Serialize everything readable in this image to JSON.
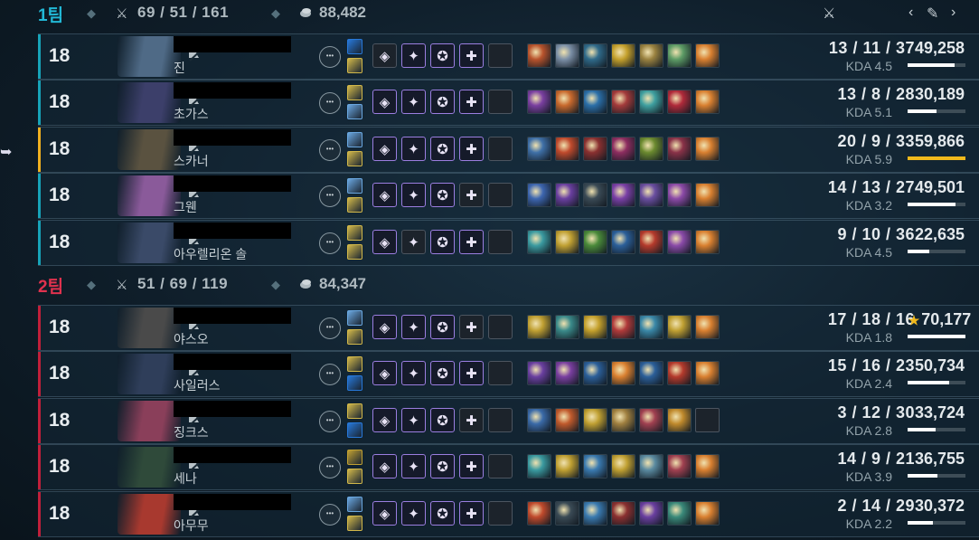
{
  "header": {
    "icons": [
      "crossed-swords-icon",
      "chevron-left-icon",
      "tools-icon",
      "chevron-right-icon"
    ]
  },
  "teams": [
    {
      "name": "1팀",
      "name_color": "#22b8d6",
      "kda": "69 / 51 / 161",
      "gold": "88,482",
      "players": [
        {
          "level": "18",
          "champion": "진",
          "score": "13 / 11 / 37",
          "kda": "KDA 4.5",
          "damage": "49,258",
          "damage_share": 0.82,
          "face": "#4f6a86",
          "spells": [
            "#2778d9",
            "#d2b84a"
          ],
          "runes": [
            "dim",
            "",
            "",
            ""
          ],
          "items": [
            "#b8532c",
            "#7b8fa6",
            "#2f6a8a",
            "#c4a02c",
            "#9a8240",
            "#5d9c66",
            "#d98030"
          ]
        },
        {
          "level": "18",
          "champion": "초가스",
          "score": "13 / 8 / 28",
          "kda": "KDA 5.1",
          "damage": "30,189",
          "damage_share": 0.5,
          "face": "#3c3f6a",
          "spells": [
            "#d2b84a",
            "#6aa7e0"
          ],
          "runes": [
            "",
            "",
            "",
            ""
          ],
          "items": [
            "#7a3fa0",
            "#c8692d",
            "#2b6fa8",
            "#a33b3b",
            "#3fa0a0",
            "#b02a3a",
            "#d98030"
          ]
        },
        {
          "level": "18",
          "champion": "스카너",
          "score": "20 / 9 / 33",
          "kda": "KDA 5.9",
          "damage": "59,866",
          "damage_share": 1.0,
          "face": "#5a5240",
          "spells": [
            "#6aa7e0",
            "#d2b84a"
          ],
          "runes": [
            "",
            "",
            "",
            ""
          ],
          "items": [
            "#3f70a8",
            "#c04a2c",
            "#8a3030",
            "#8d2d60",
            "#6b8a2f",
            "#8a3248",
            "#d98030"
          ]
        },
        {
          "level": "18",
          "champion": "그웬",
          "score": "14 / 13 / 27",
          "kda": "KDA 3.2",
          "damage": "49,501",
          "damage_share": 0.83,
          "face": "#8a5a9a",
          "spells": [
            "#6aa7e0",
            "#d2b84a"
          ],
          "runes": [
            "",
            "",
            "",
            "dim"
          ],
          "items": [
            "#3d66b0",
            "#6a3fa0",
            "#3a4a55",
            "#7a40a6",
            "#6a4ea0",
            "#8c4aa8",
            "#d98030"
          ]
        },
        {
          "level": "18",
          "champion": "아우렐리온 솔",
          "score": "9 / 10 / 36",
          "kda": "KDA 4.5",
          "damage": "22,635",
          "damage_share": 0.38,
          "face": "#3a4a68",
          "spells": [
            "#d2b84a",
            "#d2b84a"
          ],
          "runes": [
            "",
            "dim",
            "",
            ""
          ],
          "items": [
            "#3a9aa0",
            "#c0a032",
            "#4a8a3a",
            "#2b5f99",
            "#b43a2c",
            "#8a4aa8",
            "#d98030"
          ]
        }
      ]
    },
    {
      "name": "2팀",
      "name_color": "#e0324e",
      "kda": "51 / 69 / 119",
      "gold": "84,347",
      "players": [
        {
          "level": "18",
          "champion": "야스오",
          "score": "17 / 18 / 16",
          "kda": "KDA 1.8",
          "damage": "70,177",
          "damage_share": 1.0,
          "star": "★",
          "face": "#4a4a4a",
          "spells": [
            "#6aa7e0",
            "#d2b84a"
          ],
          "runes": [
            "",
            "",
            "",
            "dim"
          ],
          "items": [
            "#c0a032",
            "#3a8a8a",
            "#c4a02c",
            "#b03a3a",
            "#3a88a8",
            "#c0a032",
            "#d98030"
          ]
        },
        {
          "level": "18",
          "champion": "사일러스",
          "score": "15 / 16 / 23",
          "kda": "KDA 2.4",
          "damage": "50,734",
          "damage_share": 0.72,
          "face": "#2f3e5a",
          "spells": [
            "#d2b84a",
            "#2778d9"
          ],
          "runes": [
            "",
            "",
            "",
            ""
          ],
          "items": [
            "#6a3fa0",
            "#7a3fa0",
            "#2b5f99",
            "#d98030",
            "#2b5f99",
            "#b43a2c",
            "#d98030"
          ]
        },
        {
          "level": "18",
          "champion": "징크스",
          "score": "3 / 12 / 30",
          "kda": "KDA 2.8",
          "damage": "33,724",
          "damage_share": 0.48,
          "face": "#8a3f5a",
          "spells": [
            "#d2b84a",
            "#2778d9"
          ],
          "runes": [
            "",
            "",
            "",
            "dim"
          ],
          "items": [
            "#3a6aa8",
            "#c05a2c",
            "#c0a032",
            "#a08040",
            "#a04050",
            "#c08a2c",
            "empty"
          ]
        },
        {
          "level": "18",
          "champion": "세나",
          "score": "14 / 9 / 21",
          "kda": "KDA 3.9",
          "damage": "36,755",
          "damage_share": 0.52,
          "face": "#2f4a3a",
          "spells": [
            "#c0a032",
            "#d2b84a"
          ],
          "runes": [
            "",
            "",
            "",
            ""
          ],
          "items": [
            "#3a9aa0",
            "#c0a032",
            "#3a7ab0",
            "#c0a032",
            "#5a8aa0",
            "#a04050",
            "#d98030"
          ]
        },
        {
          "level": "18",
          "champion": "아무무",
          "score": "2 / 14 / 29",
          "kda": "KDA 2.2",
          "damage": "30,372",
          "damage_share": 0.43,
          "face": "#a8392f",
          "spells": [
            "#6aa7e0",
            "#d2b84a"
          ],
          "runes": [
            "",
            "",
            "",
            ""
          ],
          "items": [
            "#c04a2c",
            "#3a4a55",
            "#3a7ab0",
            "#8a3030",
            "#6a3fa0",
            "#3a8a7a",
            "#d98030"
          ]
        }
      ]
    }
  ]
}
